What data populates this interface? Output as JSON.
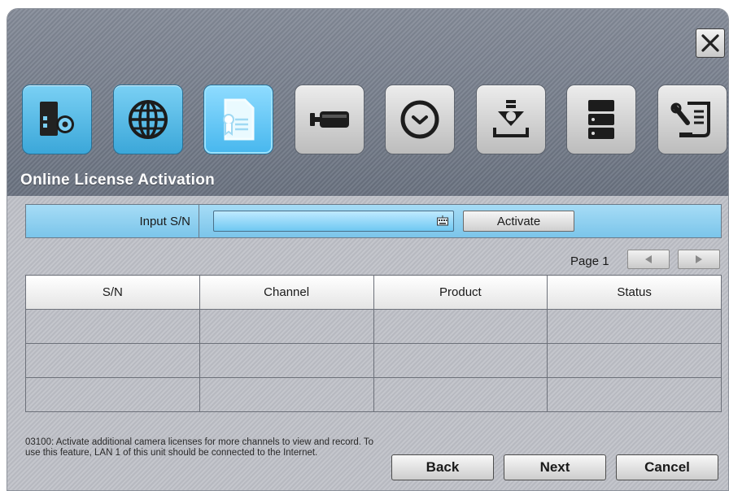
{
  "section_title": "Online License Activation",
  "toolbar": {
    "items": [
      {
        "icon": "system-settings-icon",
        "state": "active"
      },
      {
        "icon": "globe-icon",
        "state": "active"
      },
      {
        "icon": "license-certificate-icon",
        "state": "selected"
      },
      {
        "icon": "camera-icon",
        "state": "normal"
      },
      {
        "icon": "clock-icon",
        "state": "normal"
      },
      {
        "icon": "download-install-icon",
        "state": "normal"
      },
      {
        "icon": "storage-server-icon",
        "state": "normal"
      },
      {
        "icon": "tools-document-icon",
        "state": "normal"
      }
    ]
  },
  "serial": {
    "label": "Input S/N",
    "value": "",
    "activate_label": "Activate"
  },
  "pager": {
    "label": "Page 1"
  },
  "table": {
    "columns": [
      "S/N",
      "Channel",
      "Product",
      "Status"
    ],
    "rows": [
      [
        "",
        "",
        "",
        ""
      ],
      [
        "",
        "",
        "",
        ""
      ],
      [
        "",
        "",
        "",
        ""
      ]
    ]
  },
  "note": "03100: Activate additional camera licenses for more channels to view and record. To use this feature, LAN 1 of this unit should be connected to the Internet.",
  "buttons": {
    "back": "Back",
    "next": "Next",
    "cancel": "Cancel"
  },
  "colors": {
    "accent_blue": "#4bb4e6",
    "header_gray": "#737b88",
    "body_gray": "#bdbfc6"
  }
}
